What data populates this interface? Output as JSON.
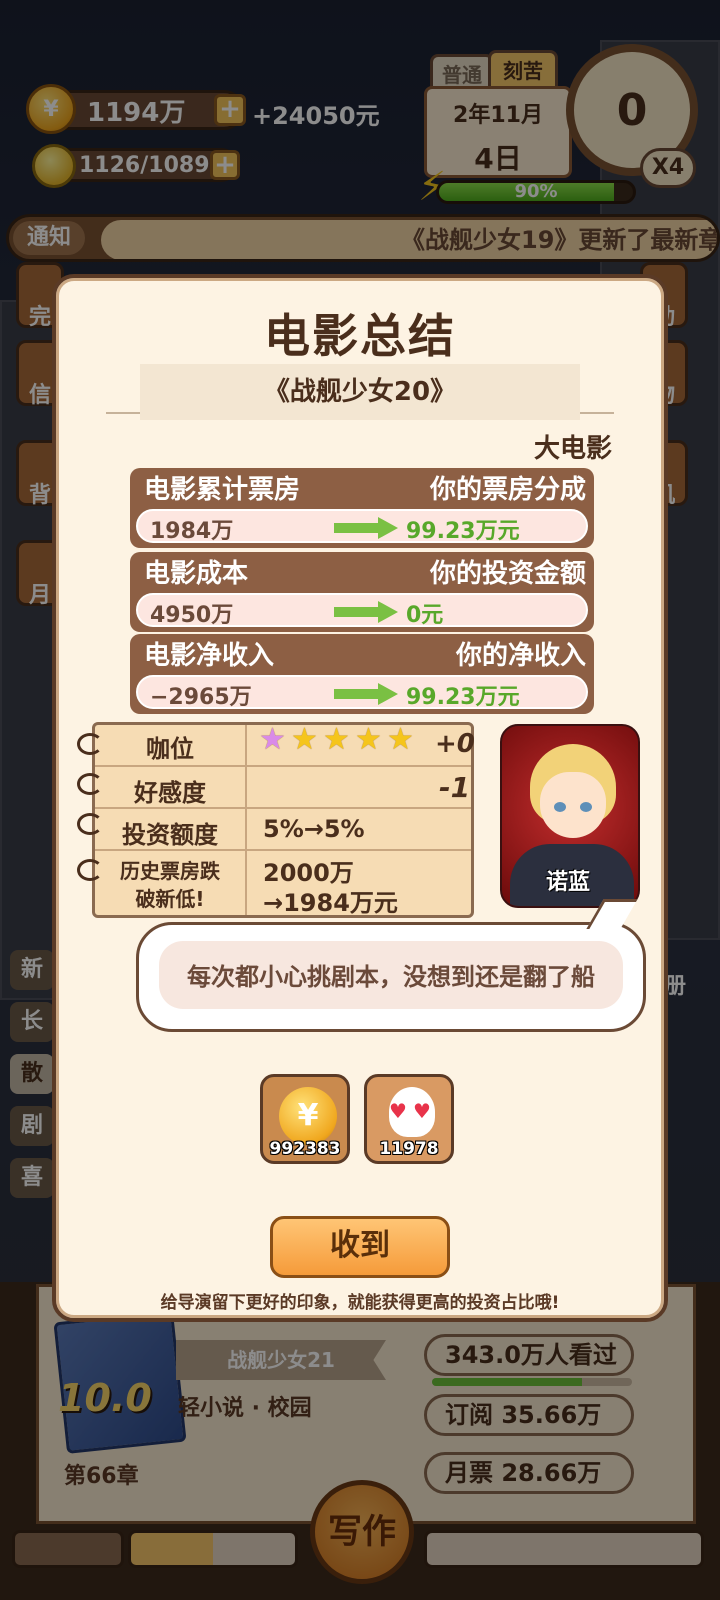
{
  "top": {
    "coins": "1194万",
    "coin_rate": "+24050元",
    "ideas": "1126/10899",
    "mode_tabs": [
      "普通",
      "刻苦"
    ],
    "date_year_month": "2年11月",
    "date_day": "4日",
    "clock_value": "0",
    "speed": "X4",
    "energy": "90%",
    "energy_fraction": 0.9
  },
  "notice": {
    "tag": "通知",
    "message": "《战舰少女19》更新了最新章"
  },
  "side_left": [
    "完",
    "信",
    "背",
    "月",
    "新",
    "长",
    "散",
    "剧",
    "喜"
  ],
  "side_right": [
    "动",
    "物",
    "机",
    "册"
  ],
  "modal": {
    "title": "电影总结",
    "movie": "《战舰少女20》",
    "category": "大电影",
    "finance": [
      {
        "left_label": "电影累计票房",
        "right_label": "你的票房分成",
        "left_value": "1984万",
        "right_value": "99.23万元"
      },
      {
        "left_label": "电影成本",
        "right_label": "你的投资金额",
        "left_value": "4950万",
        "right_value": "0元"
      },
      {
        "left_label": "电影净收入",
        "right_label": "你的净收入",
        "left_value": "−2965万",
        "right_value": "99.23万元"
      }
    ],
    "notes": {
      "rank_label": "咖位",
      "rank_stars": 5,
      "rank_change": "+0",
      "affection_label": "好感度",
      "affection_change": "-1",
      "invest_label": "投资额度",
      "invest_value": "5%→5%",
      "record_label_1": "历史票房跌",
      "record_label_2": "破新低!",
      "record_value_1": "2000万",
      "record_value_2": "→1984万元"
    },
    "character_name": "诺蓝",
    "speech": "每次都小心挑剧本，没想到还是翻了船",
    "rewards": [
      {
        "icon": "coin-icon",
        "value": "992383"
      },
      {
        "icon": "fan-icon",
        "value": "11978"
      }
    ],
    "confirm_label": "收到",
    "hint": "给导演留下更好的印象，就能获得更高的投资占比哦!"
  },
  "book": {
    "title": "战舰少女21",
    "genre": "轻小说 · 校园",
    "score": "10.0",
    "chapter": "第66章",
    "views": "343.0万人看过",
    "views_fraction": 0.75,
    "subscriptions": "订阅  35.66万",
    "monthly_tickets": "月票  28.66万",
    "write_label": "写作"
  },
  "colors": {
    "brown_dark": "#5a3a26",
    "panel": "#fdf3e3",
    "green_value": "#58a82a",
    "confirm": "#f59b3a"
  }
}
